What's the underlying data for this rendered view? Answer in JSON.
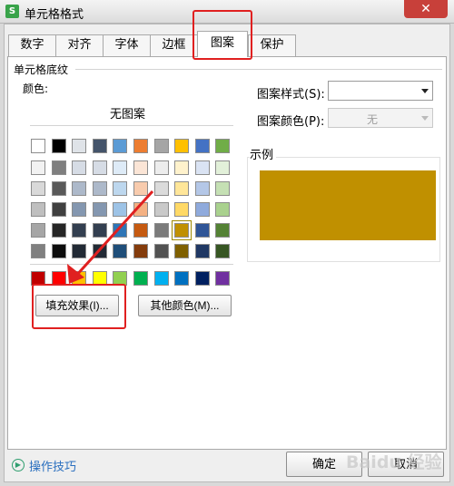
{
  "window": {
    "title": "单元格格式",
    "app_icon_glyph": "S",
    "close_glyph": "✕"
  },
  "tabs": [
    {
      "label": "数字"
    },
    {
      "label": "对齐"
    },
    {
      "label": "字体"
    },
    {
      "label": "边框"
    },
    {
      "label": "图案",
      "active": true
    },
    {
      "label": "保护"
    }
  ],
  "shading": {
    "group_title": "单元格底纹",
    "color_label": "颜色:",
    "no_pattern_label": "无图案",
    "selected_color": "#c09000",
    "palette_rows": [
      [
        "#ffffff",
        "#000000",
        "#dfe3e8",
        "#44546a",
        "#5b9bd5",
        "#ed7d31",
        "#a5a5a5",
        "#ffc000",
        "#4472c4",
        "#70ad47"
      ],
      [
        "#f2f2f2",
        "#7f7f7f",
        "#d6dce5",
        "#d6dce5",
        "#deebf7",
        "#fbe5d6",
        "#ededed",
        "#fff2cc",
        "#dae3f3",
        "#e2f0d9"
      ],
      [
        "#d9d9d9",
        "#595959",
        "#adb9ca",
        "#adb9ca",
        "#bdd7ee",
        "#f8cbad",
        "#dbdbdb",
        "#ffe699",
        "#b4c7e7",
        "#c5e0b4"
      ],
      [
        "#bfbfbf",
        "#404040",
        "#8497b0",
        "#8497b0",
        "#9dc3e6",
        "#f4b183",
        "#c9c9c9",
        "#ffd966",
        "#8faadc",
        "#a9d18e"
      ],
      [
        "#a6a6a6",
        "#262626",
        "#333f50",
        "#333f50",
        "#2e75b6",
        "#c55a11",
        "#7b7b7b",
        "#c09000",
        "#2f5597",
        "#548235"
      ],
      [
        "#808080",
        "#0d0d0d",
        "#222a35",
        "#222a35",
        "#1f4e79",
        "#843c0c",
        "#525252",
        "#7f6000",
        "#203864",
        "#375623"
      ]
    ],
    "standard_colors": [
      "#c00000",
      "#ff0000",
      "#ffc000",
      "#ffff00",
      "#92d050",
      "#00b050",
      "#00b0f0",
      "#0070c0",
      "#002060",
      "#7030a0"
    ],
    "fill_effects_button": "填充效果(I)...",
    "more_colors_button": "其他颜色(M)..."
  },
  "pattern": {
    "style_label": "图案样式(S):",
    "style_value": "",
    "color_label": "图案颜色(P):",
    "color_value": "无"
  },
  "sample": {
    "label": "示例",
    "fill_color": "#c09000"
  },
  "footer": {
    "help_link": "操作技巧",
    "ok_button": "确定",
    "cancel_button": "取消",
    "watermark": "Baidu 经验"
  }
}
